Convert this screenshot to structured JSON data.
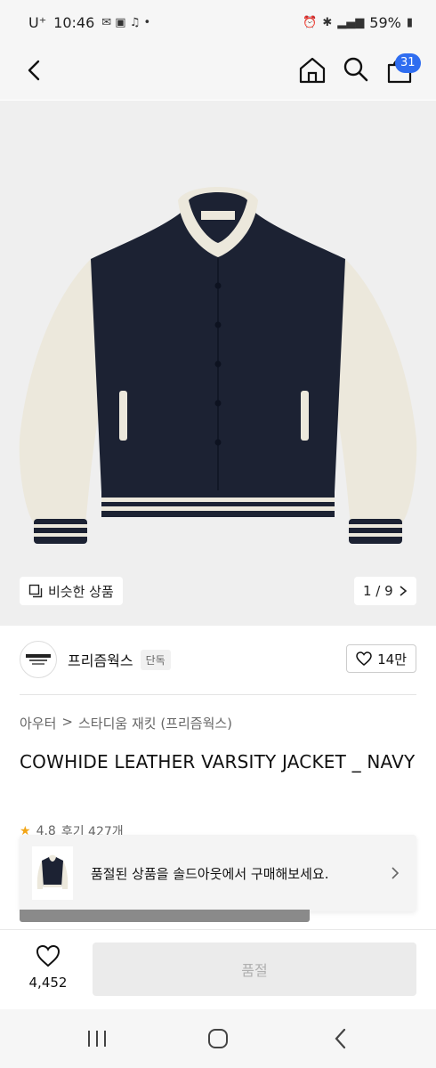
{
  "status_bar": {
    "carrier": "U⁺",
    "time": "10:46",
    "battery": "59%"
  },
  "nav": {
    "cart_count": "31"
  },
  "gallery": {
    "similar_label": "비슷한 상품",
    "pager": "1 / 9"
  },
  "brand": {
    "name": "프리즘웍스",
    "tag": "단독",
    "likes": "14만"
  },
  "breadcrumb": {
    "category": "아우터",
    "separator": ">",
    "subcategory": "스타디움 재킷 (프리즘웍스)"
  },
  "product": {
    "title": "COWHIDE LEATHER VARSITY JACKET _ NAVY"
  },
  "rating": {
    "score": "4.8",
    "reviews": "후기 427개"
  },
  "banner": {
    "text": "품절된 상품을 솔드아웃에서 구매해보세요."
  },
  "bottom": {
    "wish_count": "4,452",
    "buy_label": "품절"
  },
  "colors": {
    "accent": "#2f6df0",
    "navy": "#1c2233",
    "cream": "#ece8dc"
  }
}
